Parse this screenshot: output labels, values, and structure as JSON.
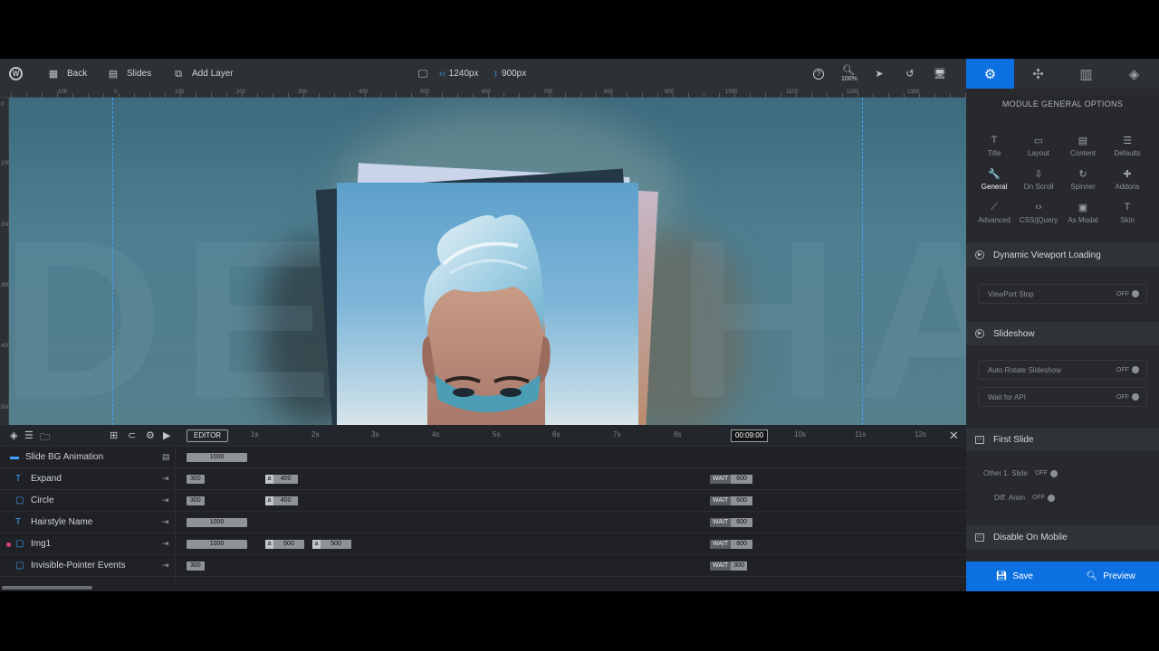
{
  "toolbar": {
    "back_label": "Back",
    "slides_label": "Slides",
    "add_layer_label": "Add Layer",
    "width_value": "1240px",
    "height_value": "900px",
    "zoom_value": "100%",
    "wp_icon": "wordpress-icon"
  },
  "ruler": {
    "h_ticks": [
      "-100",
      "0",
      "100",
      "200",
      "300",
      "400",
      "500",
      "600",
      "700",
      "800",
      "900",
      "1000",
      "1100",
      "1200",
      "1300"
    ],
    "v_ticks": [
      "0",
      "100",
      "200",
      "300",
      "400",
      "500"
    ]
  },
  "canvas": {
    "bg_text": "DEPTHAV"
  },
  "panel": {
    "tabs": [
      "gear-icon",
      "modules-icon",
      "library-icon",
      "layers-icon"
    ],
    "title": "MODULE GENERAL OPTIONS",
    "options": [
      {
        "label": "Title",
        "icon": "T"
      },
      {
        "label": "Layout",
        "icon": "▭"
      },
      {
        "label": "Content",
        "icon": "▤"
      },
      {
        "label": "Defaults",
        "icon": "☰"
      },
      {
        "label": "General",
        "icon": "🔧"
      },
      {
        "label": "On Scroll",
        "icon": "⇩"
      },
      {
        "label": "Spinner",
        "icon": "↻"
      },
      {
        "label": "Addons",
        "icon": "✚"
      },
      {
        "label": "Advanced",
        "icon": "⟋"
      },
      {
        "label": "CSS/jQuery",
        "icon": "‹›"
      },
      {
        "label": "As Modal",
        "icon": "▣"
      },
      {
        "label": "Skin",
        "icon": "T"
      }
    ],
    "sections": {
      "dynamic": "Dynamic Viewport Loading",
      "viewport_stop": "ViewPort Stop",
      "slideshow": "Slideshow",
      "auto_rotate": "Auto Rotate Slideshow",
      "wait_api": "Wait for API",
      "first_slide": "First Slide",
      "other_slide": "Other 1. Slide",
      "diff_anim": "Diff. Anim",
      "disable_mobile": "Disable On Mobile"
    },
    "toggle_off": "OFF",
    "save_label": "Save",
    "preview_label": "Preview"
  },
  "timeline": {
    "editor_label": "EDITOR",
    "seconds": [
      "1s",
      "2s",
      "3s",
      "4s",
      "5s",
      "6s",
      "7s",
      "8s",
      "10s",
      "11s",
      "12s"
    ],
    "current_time": "00:09:00",
    "wait_label": "WAIT",
    "a_label": "a",
    "layers": [
      {
        "name": "Slide BG Animation",
        "icon": "image-icon",
        "bars": [
          "1000"
        ]
      },
      {
        "name": "Expand",
        "icon": "text-icon",
        "bars": [
          "300",
          "400"
        ],
        "wait": "600"
      },
      {
        "name": "Circle",
        "icon": "shape-icon",
        "bars": [
          "300",
          "400"
        ],
        "wait": "600"
      },
      {
        "name": "Hairstyle Name",
        "icon": "text-icon",
        "bars": [
          "1000"
        ],
        "wait": "600"
      },
      {
        "name": "Img1",
        "icon": "shape-icon",
        "bars": [
          "1000",
          "500",
          "500"
        ],
        "wait": "600"
      },
      {
        "name": "Invisible-Pointer Events",
        "icon": "shape-icon",
        "bars": [
          "300"
        ],
        "wait": "300"
      }
    ]
  },
  "colors": {
    "accent": "#0d70e0",
    "panel_bg": "#27292d",
    "toolbar_bg": "#2d3035",
    "guide": "#3fa1ff"
  }
}
